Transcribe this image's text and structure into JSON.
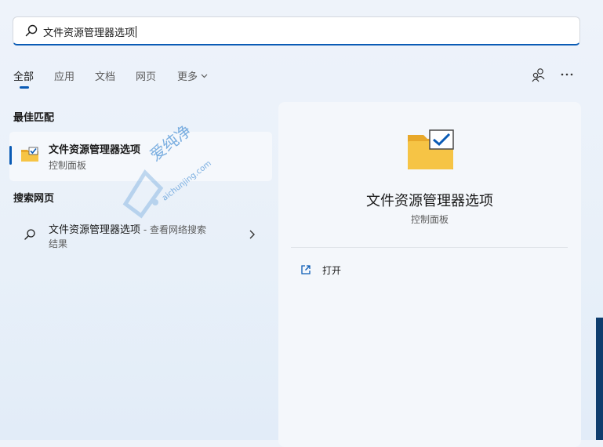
{
  "search": {
    "query": "文件资源管理器选项"
  },
  "tabs": [
    {
      "label": "全部"
    },
    {
      "label": "应用"
    },
    {
      "label": "文档"
    },
    {
      "label": "网页"
    },
    {
      "label": "更多"
    }
  ],
  "best_match": {
    "heading": "最佳匹配",
    "title": "文件资源管理器选项",
    "subtitle": "控制面板"
  },
  "web_search": {
    "heading": "搜索网页",
    "title": "文件资源管理器选项",
    "suffix": " - 查看网络搜索",
    "subtitle": "结果"
  },
  "detail": {
    "title": "文件资源管理器选项",
    "subtitle": "控制面板",
    "actions": [
      {
        "label": "打开"
      }
    ]
  },
  "watermark": {
    "text": "爱纯净",
    "url": "aichunjing.com"
  },
  "colors": {
    "accent": "#0a5bb5",
    "folder": "#f6c445"
  }
}
